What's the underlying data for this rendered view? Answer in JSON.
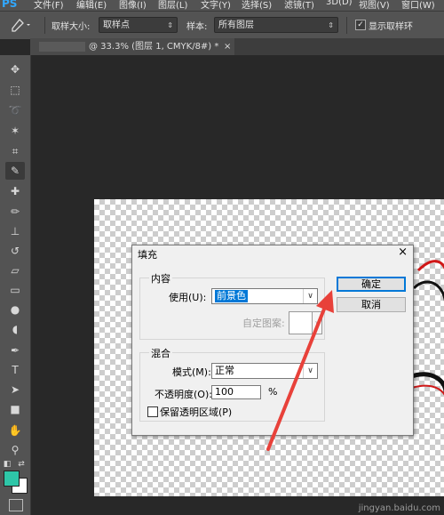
{
  "app": {
    "logo": "PS"
  },
  "menu": [
    "文件(F)",
    "编辑(E)",
    "图像(I)",
    "图层(L)",
    "文字(Y)",
    "选择(S)",
    "滤镜(T)",
    "3D(D)",
    "视图(V)",
    "窗口(W)"
  ],
  "options": {
    "sample_size_label": "取样大小:",
    "sample_size_value": "取样点",
    "sample_label": "样本:",
    "sample_value": "所有图层",
    "show_ring_label": "显示取样环",
    "show_ring_checked": true
  },
  "tab": {
    "title": "@ 33.3% (图层 1, CMYK/8#) *",
    "close": "×"
  },
  "tools": [
    "move-icon",
    "marquee-icon",
    "lasso-icon",
    "magic-wand-icon",
    "crop-icon",
    "eyedropper-icon",
    "healing-brush-icon",
    "brush-icon",
    "clone-stamp-icon",
    "history-brush-icon",
    "eraser-icon",
    "gradient-icon",
    "blur-icon",
    "dodge-icon",
    "pen-icon",
    "type-icon",
    "path-selection-icon",
    "rectangle-icon",
    "hand-icon",
    "zoom-icon"
  ],
  "colors": {
    "foreground": "#2ec6a8",
    "background": "#ffffff"
  },
  "dialog": {
    "title": "填充",
    "close": "×",
    "content_group": "内容",
    "use_label": "使用(U):",
    "use_value": "前景色",
    "custom_pattern_label": "自定图案:",
    "blend_group": "混合",
    "mode_label": "模式(M):",
    "mode_value": "正常",
    "opacity_label": "不透明度(O):",
    "opacity_value": "100",
    "opacity_unit": "%",
    "preserve_label": "保留透明区域(P)",
    "preserve_checked": false,
    "ok_button": "确定",
    "cancel_button": "取消"
  },
  "watermark": "jingyan.baidu.com"
}
